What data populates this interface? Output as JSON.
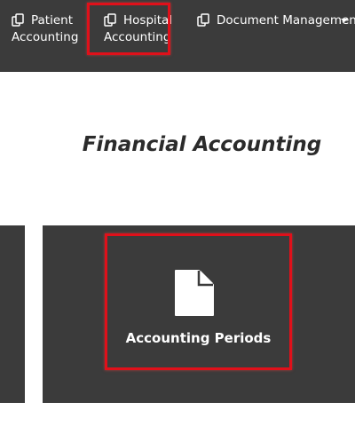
{
  "colors": {
    "navbar_bg": "#3b3b3b",
    "tile_bg": "#3b3b3b",
    "highlight": "#e0101a",
    "text_light": "#ffffff",
    "text_dark": "#2b2b2b"
  },
  "navbar": {
    "items": [
      {
        "line1": "Patient",
        "line2": "Accounting",
        "icon": "copy-icon"
      },
      {
        "line1": "Hospital",
        "line2": "Accounting",
        "icon": "copy-icon"
      },
      {
        "line1": "Document Management",
        "icon": "copy-icon",
        "dropdown": true
      }
    ]
  },
  "main": {
    "title": "Financial Accounting",
    "tiles": [
      {
        "label": "Accounting Periods",
        "icon": "document-icon"
      }
    ]
  }
}
